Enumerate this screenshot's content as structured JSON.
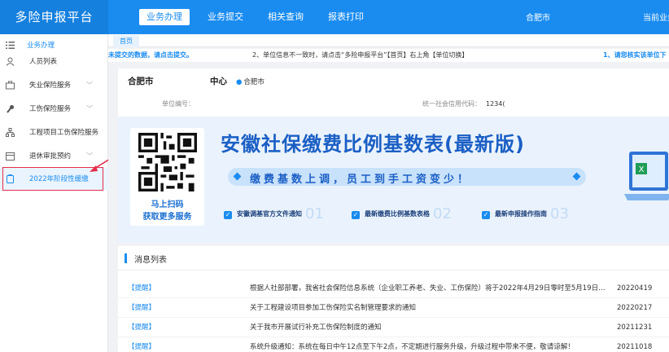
{
  "app": {
    "title": "多险申报平台"
  },
  "topnav": {
    "items": [
      "业务办理",
      "业务提交",
      "相关查询",
      "报表打印"
    ],
    "city": "合肥市",
    "user": "当前业务"
  },
  "sidebar": {
    "items": [
      {
        "label": "业务办理",
        "icon": "menu-list-icon"
      },
      {
        "label": "人员列表",
        "icon": "person-icon"
      },
      {
        "label": "失业保险服务",
        "icon": "briefcase-icon"
      },
      {
        "label": "工伤保险服务",
        "icon": "wrench-icon"
      },
      {
        "label": "工程项目工伤保险服务",
        "icon": "org-chart-icon"
      },
      {
        "label": "退休审批预约",
        "icon": "calendar-icon"
      },
      {
        "label": "2022年阶段性缓缴",
        "icon": "clipboard-icon"
      }
    ],
    "highlight_color": "#e52e4a"
  },
  "tabs": {
    "home": "首页"
  },
  "notice": {
    "part1": "未提交的数据，请点击提交。",
    "part2": "2、单位信息不一致时，请点击“多险申报平台”【首页】右上角【单位切换】",
    "part3": "1、请您核实该单位下"
  },
  "info": {
    "city": "合肥市",
    "center": "中心",
    "location": "合肥市",
    "unit_no_label": "单位编号：",
    "credit_label": "统一社会信用代码：",
    "credit_value": "1234("
  },
  "banner": {
    "qr_line1": "马上扫码",
    "qr_line2": "获取更多服务",
    "title": "安徽社保缴费比例基数表(最新版)",
    "subtitle": "缴费基数上调，员工到手工资变少！",
    "links": [
      {
        "label": "安徽调基官方文件通知",
        "num": "01"
      },
      {
        "label": "最新缴费比例基数表格",
        "num": "02"
      },
      {
        "label": "最新申报操作指南",
        "num": "03"
      }
    ]
  },
  "messages": {
    "title": "消息列表",
    "rows": [
      {
        "tag": "【提醒】",
        "text": "根据人社部部署，我省社会保险信息系统（企业职工养老、失业、工伤保险）将于2022年4月29日零时至5月19日…",
        "date": "20220419"
      },
      {
        "tag": "【提醒】",
        "text": "关于工程建设项目参加工伤保险实名制管理要求的通知",
        "date": "20220217"
      },
      {
        "tag": "【提醒】",
        "text": "关于我市开展试行补充工伤保险制度的通知",
        "date": "20211231"
      },
      {
        "tag": "【提醒】",
        "text": "系统升级通知：系统在每日中午12点至下午2点，不定期进行服务升级，升级过程中带来不便，敬请谅解！",
        "date": "20211018"
      }
    ]
  },
  "colors": {
    "primary": "#1a8cf0",
    "banner_title": "#1b5fc4",
    "annotation_red": "#e52e4a"
  }
}
